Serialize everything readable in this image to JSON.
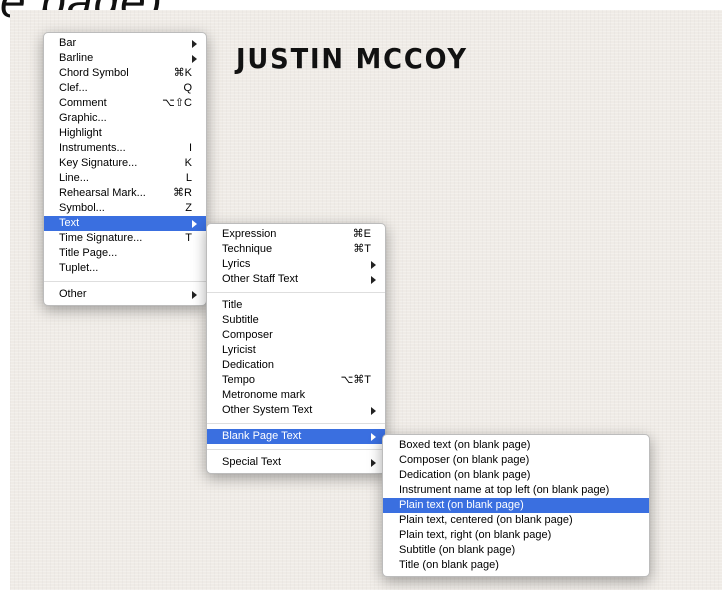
{
  "heading_fragment": "e  page)",
  "score": {
    "title": "JUSTIN MCCOY"
  },
  "menu_main": {
    "items": [
      {
        "label": "Bar",
        "submenu": true
      },
      {
        "label": "Barline",
        "submenu": true
      },
      {
        "label": "Chord Symbol",
        "shortcut": "⌘K"
      },
      {
        "label": "Clef...",
        "shortcut": "Q"
      },
      {
        "label": "Comment",
        "shortcut": "⌥⇧C"
      },
      {
        "label": "Graphic..."
      },
      {
        "label": "Highlight"
      },
      {
        "label": "Instruments...",
        "shortcut": "I"
      },
      {
        "label": "Key Signature...",
        "shortcut": "K"
      },
      {
        "label": "Line...",
        "shortcut": "L"
      },
      {
        "label": "Rehearsal Mark...",
        "shortcut": "⌘R"
      },
      {
        "label": "Symbol...",
        "shortcut": "Z"
      },
      {
        "label": "Text",
        "submenu": true,
        "selected": true
      },
      {
        "label": "Time Signature...",
        "shortcut": "T"
      },
      {
        "label": "Title Page..."
      },
      {
        "label": "Tuplet..."
      },
      {
        "label": "Other",
        "submenu": true
      }
    ]
  },
  "menu_text": {
    "items": [
      {
        "label": "Expression",
        "shortcut": "⌘E"
      },
      {
        "label": "Technique",
        "shortcut": "⌘T"
      },
      {
        "label": "Lyrics",
        "submenu": true
      },
      {
        "label": "Other Staff Text",
        "submenu": true
      },
      {
        "label": "Title"
      },
      {
        "label": "Subtitle"
      },
      {
        "label": "Composer"
      },
      {
        "label": "Lyricist"
      },
      {
        "label": "Dedication"
      },
      {
        "label": "Tempo",
        "shortcut": "⌥⌘T"
      },
      {
        "label": "Metronome mark"
      },
      {
        "label": "Other System Text",
        "submenu": true
      },
      {
        "label": "Blank Page Text",
        "submenu": true,
        "selected": true
      },
      {
        "label": "Special Text",
        "submenu": true
      }
    ]
  },
  "menu_blank_page": {
    "items": [
      {
        "label": "Boxed text (on blank page)"
      },
      {
        "label": "Composer (on blank page)"
      },
      {
        "label": "Dedication (on blank page)"
      },
      {
        "label": "Instrument name at top left (on blank page)"
      },
      {
        "label": "Plain text (on blank page)",
        "selected": true
      },
      {
        "label": "Plain text, centered (on blank page)"
      },
      {
        "label": "Plain text, right (on blank page)"
      },
      {
        "label": "Subtitle (on blank page)"
      },
      {
        "label": "Title (on blank page)"
      }
    ]
  },
  "colors": {
    "selection": "#3a6fe0",
    "paper": "#efebe6"
  }
}
